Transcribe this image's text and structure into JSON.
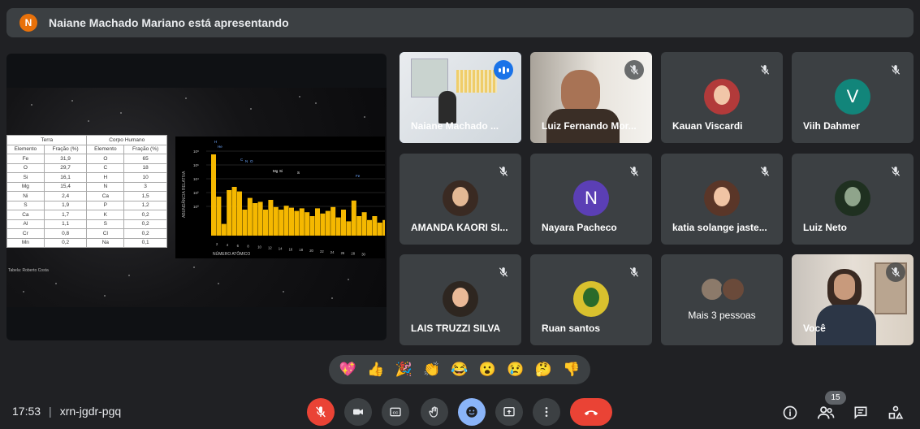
{
  "banner": {
    "avatar_letter": "N",
    "text": "Naiane Machado Mariano está apresentando",
    "avatar_color": "#e8710a"
  },
  "slide": {
    "table": {
      "groups": [
        "Terra",
        "Corpo Humano"
      ],
      "headers": [
        "Elemento",
        "Fração (%)",
        "Elemento",
        "Fração (%)"
      ],
      "rows": [
        [
          "Fe",
          "31,9",
          "O",
          "65"
        ],
        [
          "O",
          "29,7",
          "C",
          "18"
        ],
        [
          "Si",
          "16,1",
          "H",
          "10"
        ],
        [
          "Mg",
          "15,4",
          "N",
          "3"
        ],
        [
          "Ni",
          "2,4",
          "Ca",
          "1,5"
        ],
        [
          "S",
          "1,9",
          "P",
          "1,2"
        ],
        [
          "Ca",
          "1,7",
          "K",
          "0,2"
        ],
        [
          "Al",
          "1,1",
          "S",
          "0,2"
        ],
        [
          "Cr",
          "0,8",
          "Cl",
          "0,2"
        ],
        [
          "Mn",
          "0,2",
          "Na",
          "0,1"
        ]
      ],
      "credit": "Tabela: Roberto Costa"
    },
    "chart": {
      "ylabel": "ABUNDÂNCIA RELATIVA",
      "xlabel": "NÚMERO ATÔMICO",
      "yticks": [
        "10⁸",
        "10⁶",
        "10⁴",
        "10²",
        "10⁰"
      ],
      "xticks": [
        "2",
        "4",
        "6",
        "8",
        "10",
        "12",
        "14",
        "16",
        "18",
        "20",
        "22",
        "24",
        "26",
        "28",
        "30"
      ],
      "labels": [
        "H",
        "He",
        "C",
        "N",
        "O",
        "Mg",
        "Si",
        "S",
        "Fe"
      ],
      "bar_color": "#f5b800"
    }
  },
  "tiles": [
    {
      "name": "Naiane Machado ...",
      "kind": "video-slide"
    },
    {
      "name": "Luiz Fernando Mor...",
      "kind": "video-man"
    },
    {
      "name": "Kauan Viscardi",
      "kind": "photo"
    },
    {
      "name": "Viih Dahmer",
      "kind": "letter",
      "letter": "V",
      "color": "#12857a"
    },
    {
      "name": "AMANDA KAORI SI...",
      "kind": "photo"
    },
    {
      "name": "Nayara Pacheco",
      "kind": "letter",
      "letter": "N",
      "color": "#5b3fb5"
    },
    {
      "name": "katia solange jaste...",
      "kind": "photo"
    },
    {
      "name": "Luiz Neto",
      "kind": "photo"
    },
    {
      "name": "LAIS TRUZZI SILVA",
      "kind": "photo"
    },
    {
      "name": "Ruan santos",
      "kind": "photo"
    },
    {
      "name": "Mais 3 pessoas",
      "kind": "more"
    },
    {
      "name": "Você",
      "kind": "self"
    }
  ],
  "reactions": [
    "💖",
    "👍",
    "🎉",
    "👏",
    "😂",
    "😮",
    "😢",
    "🤔",
    "👎"
  ],
  "meeting": {
    "time": "17:53",
    "separator": "|",
    "code": "xrn-jgdr-pgq"
  },
  "people_count": "15",
  "icons": {
    "mic": "mic-off-icon",
    "cam": "camera-icon",
    "cc": "captions-icon",
    "hand": "raise-hand-icon",
    "emoji": "emoji-icon",
    "present": "present-icon",
    "more": "more-vert-icon",
    "hangup": "phone-hangup-icon",
    "info": "info-icon",
    "people": "people-icon",
    "chat": "chat-icon",
    "activities": "activities-icon"
  },
  "colors": {
    "accent": "#8ab4f8",
    "danger": "#ea4335",
    "surface": "#3c4043",
    "background": "#202124"
  }
}
